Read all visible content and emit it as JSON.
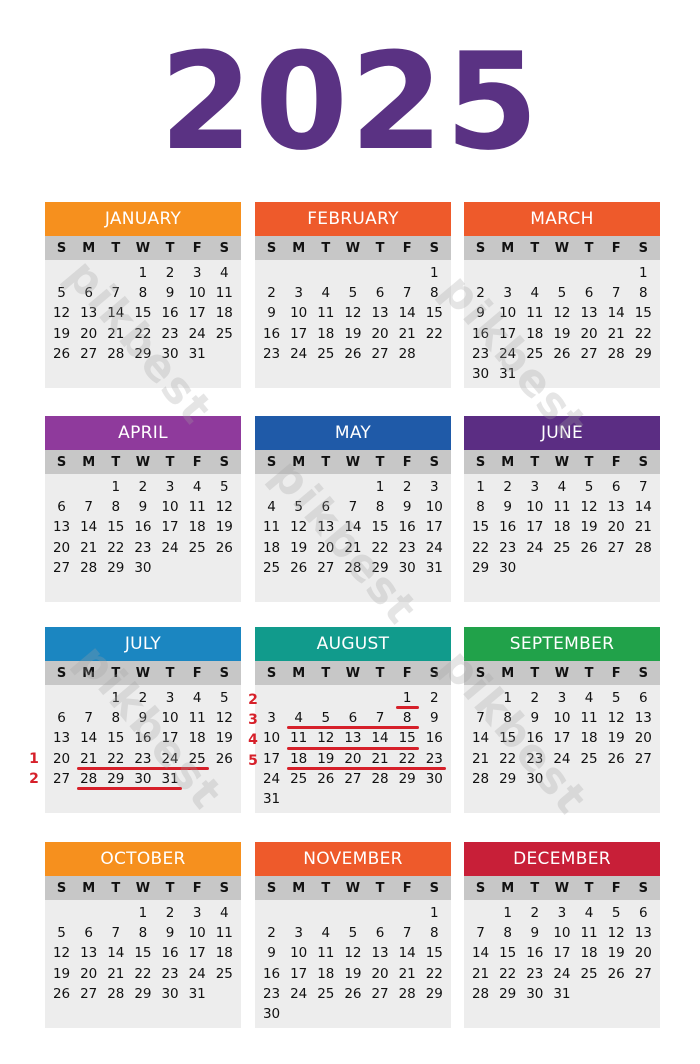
{
  "year": "2025",
  "title_color": "#5a3283",
  "weekday_labels": [
    "S",
    "M",
    "T",
    "W",
    "T",
    "F",
    "S"
  ],
  "watermark": "pikbest",
  "months": [
    {
      "name": "JANUARY",
      "color": "#f6901e",
      "start": 3,
      "days": 31
    },
    {
      "name": "FEBRUARY",
      "color": "#ee5a2b",
      "start": 6,
      "days": 28
    },
    {
      "name": "MARCH",
      "color": "#ee5a2b",
      "start": 6,
      "days": 31
    },
    {
      "name": "APRIL",
      "color": "#8f3a9c",
      "start": 2,
      "days": 30
    },
    {
      "name": "MAY",
      "color": "#1f5aa8",
      "start": 4,
      "days": 31
    },
    {
      "name": "JUNE",
      "color": "#5b2d83",
      "start": 0,
      "days": 30
    },
    {
      "name": "JULY",
      "color": "#1b86c1",
      "start": 2,
      "days": 31
    },
    {
      "name": "AUGUST",
      "color": "#119b8c",
      "start": 5,
      "days": 31
    },
    {
      "name": "SEPTEMBER",
      "color": "#21a24a",
      "start": 1,
      "days": 30
    },
    {
      "name": "OCTOBER",
      "color": "#f6901e",
      "start": 3,
      "days": 31
    },
    {
      "name": "NOVEMBER",
      "color": "#ee5a2b",
      "start": 6,
      "days": 30
    },
    {
      "name": "DECEMBER",
      "color": "#c81f38",
      "start": 1,
      "days": 31
    }
  ],
  "annotations": {
    "color": "#d6202a",
    "july_week_marks": [
      "1",
      "2"
    ],
    "august_week_marks": [
      "2",
      "3",
      "4",
      "5"
    ]
  }
}
